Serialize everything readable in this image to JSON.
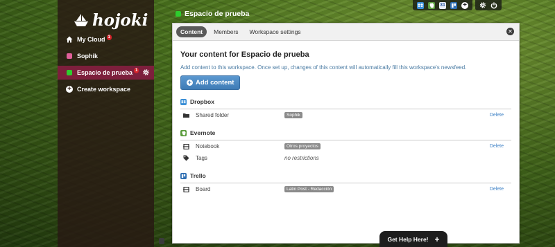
{
  "app": {
    "logo_text": "hojoki"
  },
  "sidebar": {
    "items": [
      {
        "label": "My Cloud",
        "badge": "1",
        "icon": "home-icon"
      },
      {
        "label": "Sophik",
        "icon": "pink-square-icon",
        "color": "#e0609a"
      },
      {
        "label": "Espacio de prueba",
        "badge": "1",
        "icon": "green-square-icon",
        "color": "#2ecc2e",
        "active": true
      },
      {
        "label": "Create workspace",
        "icon": "plus-circle-icon"
      }
    ]
  },
  "header": {
    "workspace_title": "Espacio de prueba",
    "calendar_day": "31"
  },
  "panel": {
    "tabs": [
      {
        "label": "Content",
        "active": true
      },
      {
        "label": "Members"
      },
      {
        "label": "Workspace settings"
      }
    ],
    "heading": "Your content for Espacio de prueba",
    "description": "Add content to this workspace. Once set up, changes of this content will automatically fill this workspace's newsfeed.",
    "add_button": "Add content",
    "sections": [
      {
        "name": "Dropbox",
        "rows": [
          {
            "label": "Shared folder",
            "value": "Sophik",
            "value_style": "tag",
            "action": "Delete"
          }
        ]
      },
      {
        "name": "Evernote",
        "rows": [
          {
            "label": "Notebook",
            "value": "Otros proyectos",
            "value_style": "tag",
            "action": "Delete"
          },
          {
            "label": "Tags",
            "value": "no restrictions",
            "value_style": "italic"
          }
        ]
      },
      {
        "name": "Trello",
        "rows": [
          {
            "label": "Board",
            "value": "Latin Post - Redacción",
            "value_style": "tag",
            "action": "Delete"
          }
        ]
      }
    ]
  },
  "help": {
    "label": "Get Help Here!"
  },
  "colors": {
    "active_nav": "#7d1f3c",
    "link": "#3b7fc4",
    "button": "#4a88c2"
  }
}
